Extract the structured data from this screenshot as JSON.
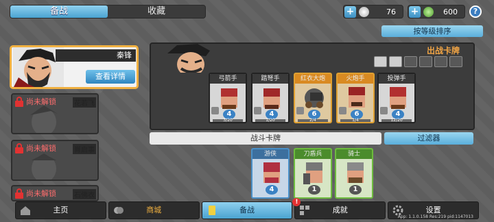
{
  "top_tabs": [
    {
      "label": "备战",
      "active": true
    },
    {
      "label": "收藏",
      "active": false
    }
  ],
  "resources": {
    "silver": {
      "value": "76",
      "icon": "silver-coin-icon"
    },
    "gem": {
      "value": "600",
      "icon": "green-gem-icon"
    },
    "help_label": "?"
  },
  "sort_label": "按等级排序",
  "heroes": {
    "selected": {
      "name": "秦锋",
      "detail_label": "查看详情"
    },
    "locked": [
      {
        "status": "尚未解锁",
        "name": "花若飞"
      },
      {
        "status": "尚未解锁",
        "name": "肖启事"
      },
      {
        "status": "尚未解锁",
        "name": "石佛衣"
      }
    ]
  },
  "battle": {
    "title": "出战卡牌",
    "cards": [
      {
        "name": "弓箭手",
        "cost": "4",
        "level": "3/20",
        "tier": "gray"
      },
      {
        "name": "踏弩手",
        "cost": "4",
        "level": "1/20",
        "tier": "gray"
      },
      {
        "name": "红衣大炮",
        "cost": "6",
        "level": "2/4",
        "tier": "orange"
      },
      {
        "name": "火炮手",
        "cost": "6",
        "level": "1/4",
        "tier": "orange"
      },
      {
        "name": "投弹手",
        "cost": "4",
        "level": "12/20",
        "tier": "gray"
      }
    ]
  },
  "combat": {
    "label": "战斗卡牌",
    "filter_label": "过滤器",
    "cards": [
      {
        "name": "游侠",
        "cost": "4",
        "tier": "blue"
      },
      {
        "name": "刀盾兵",
        "cost": "1",
        "tier": "green"
      },
      {
        "name": "骑士",
        "cost": "1",
        "tier": "green"
      }
    ]
  },
  "nav": [
    {
      "label": "主页",
      "icon": "home-icon"
    },
    {
      "label": "商城",
      "icon": "coins-icon"
    },
    {
      "label": "备战",
      "icon": "cards-icon",
      "badge": "!"
    },
    {
      "label": "成就",
      "icon": "achievement-icon"
    },
    {
      "label": "设置",
      "icon": "gear-icon"
    }
  ],
  "version": "App: 1.1.0.158 Res:219 pid:1147013",
  "colors": {
    "accent": "#4aa3d0",
    "highlight": "#f0b040",
    "locked": "#ff6d6d"
  }
}
